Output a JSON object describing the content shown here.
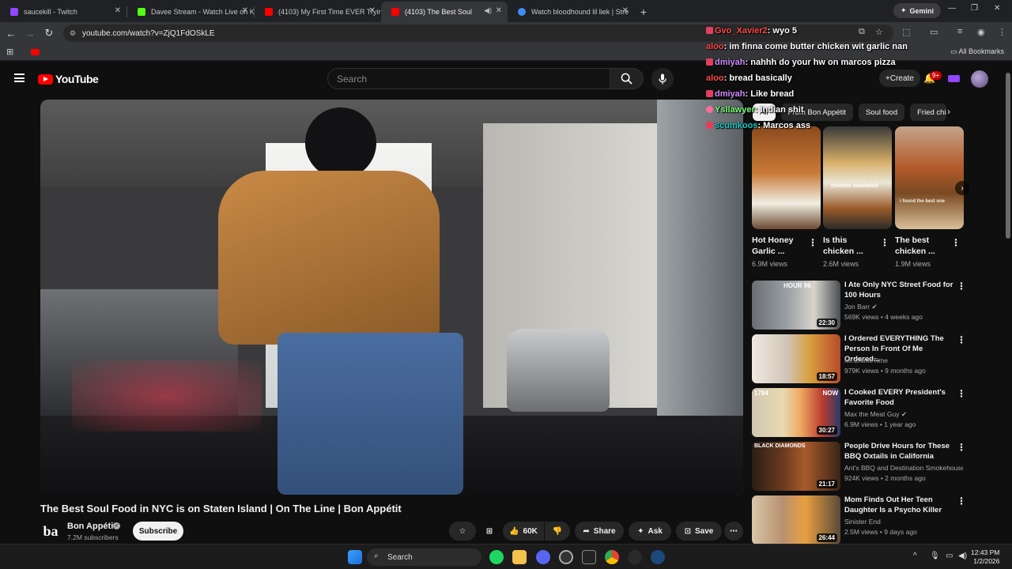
{
  "browser": {
    "tabs": [
      {
        "title": "saucekill - Twitch",
        "favicon_color": "#9146ff"
      },
      {
        "title": "Davee Stream - Watch Live on Kick",
        "favicon_color": "#53fc18"
      },
      {
        "title": "(4103) My First Time EVER Trying",
        "favicon_color": "#ff0000"
      },
      {
        "title": "(4103) The Best Soul Food in NYC",
        "favicon_color": "#ff0000",
        "active": true
      },
      {
        "title": "Watch bloodhound lil liek | Stre",
        "favicon_color": "#3d8ef0"
      }
    ],
    "gemini_label": "Gemini",
    "url": "youtube.com/watch?v=ZjQ1FdOSkLE",
    "all_bookmarks_label": "All Bookmarks"
  },
  "youtube": {
    "logo_text": "YouTube",
    "search_placeholder": "Search",
    "create_label": "Create",
    "notif_count": "9+",
    "video": {
      "title": "The Best Soul Food in NYC is on Staten Island | On The Line | Bon Appétit",
      "channel": "Bon Appétit",
      "channel_logo_text": "ba",
      "subscribers": "7.2M subscribers",
      "subscribe_label": "Subscribe",
      "likes": "60K",
      "share_label": "Share",
      "ask_label": "Ask",
      "save_label": "Save"
    },
    "chips": [
      "All",
      "From Bon Appétit",
      "Soul food",
      "Fried chi"
    ],
    "shorts": [
      {
        "title": "Hot Honey Garlic ...",
        "views": "6.9M views"
      },
      {
        "title": "Is this chicken ...",
        "views": "2.6M views",
        "overlay": "chicken sandwich"
      },
      {
        "title": "The best chicken ...",
        "views": "1.9M views",
        "overlay": "i found the best one"
      }
    ],
    "recommendations": [
      {
        "title": "I Ate Only NYC Street Food for 100 Hours",
        "channel": "Jon Barr",
        "verified": true,
        "meta": "569K views • 4 weeks ago",
        "duration": "22:30",
        "thumb_text": "HOUR 96"
      },
      {
        "title": "I Ordered EVERYTHING The Person In Front Of Me Ordered...",
        "channel": "Mr.ChimeTime",
        "verified": false,
        "meta": "979K views • 9 months ago",
        "duration": "18:57",
        "thumb_text": ""
      },
      {
        "title": "I Cooked EVERY President's Favorite Food",
        "channel": "Max the Meat Guy",
        "verified": true,
        "meta": "6.9M views • 1 year ago",
        "duration": "30:27",
        "thumb_text": "1784",
        "thumb_text2": "NOW"
      },
      {
        "title": "People Drive Hours for These BBQ Oxtails in California",
        "channel": "Ant's BBQ and Destination Smokehouse",
        "verified": false,
        "meta": "924K views • 2 months ago",
        "duration": "21:17",
        "thumb_text": "BLACK DIAMONDS"
      },
      {
        "title": "Mom Finds Out Her Teen Daughter Is a Psycho Killer",
        "channel": "Sinister End",
        "verified": false,
        "meta": "2.5M views • 9 days ago",
        "duration": "26:44",
        "thumb_text": ""
      }
    ]
  },
  "chat": [
    {
      "user": "Gvo_Xavier2",
      "user_color": "#ff4a4a",
      "message": "wyo 5"
    },
    {
      "user": "aloo",
      "user_color": "#ff4a4a",
      "message": "im finna come butter chicken wit garlic nan"
    },
    {
      "user": "dmiyah",
      "user_color": "#d08cff",
      "message": "nahhh do your hw on marcos pizza"
    },
    {
      "user": "aloo",
      "user_color": "#ff4a4a",
      "message": "bread basically"
    },
    {
      "user": "dmiyah",
      "user_color": "#d08cff",
      "message": "Like bread"
    },
    {
      "user": "Ysllawyer",
      "user_color": "#7cff7c",
      "message": "Indian shit"
    },
    {
      "user": "scumkoos",
      "user_color": "#19c8c8",
      "message": "Marcos ass"
    }
  ],
  "taskbar": {
    "search_label": "Search",
    "time": "12:43 PM",
    "date": "1/2/2026"
  }
}
